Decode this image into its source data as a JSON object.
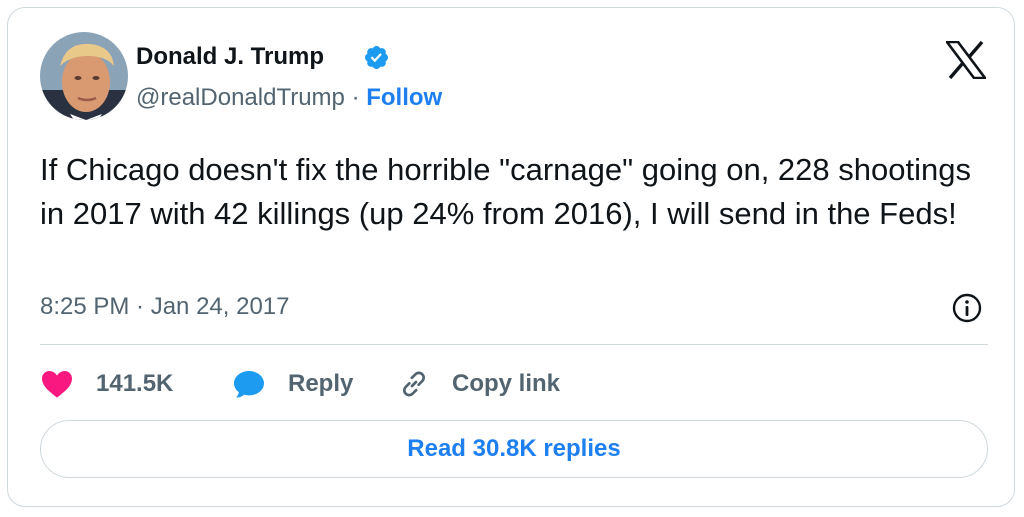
{
  "author": {
    "name": "Donald J. Trump",
    "handle": "@realDonaldTrump",
    "separator": "·",
    "follow_label": "Follow",
    "verified": true
  },
  "tweet": {
    "text": "If Chicago doesn't fix the horrible \"carnage\" going on, 228 shootings in 2017 with 42 killings (up 24% from 2016), I will send in the Feds!",
    "timestamp": "8:25 PM · Jan 24, 2017"
  },
  "actions": {
    "like_count": "141.5K",
    "reply_label": "Reply",
    "copy_label": "Copy link"
  },
  "read_replies_label": "Read 30.8K replies",
  "icons": {
    "platform": "x-logo-icon",
    "verified": "verified-badge-icon",
    "info": "info-icon",
    "like": "heart-icon",
    "reply": "speech-bubble-icon",
    "copy": "link-icon"
  },
  "colors": {
    "accent": "#1d9bf0",
    "link": "#1d7ff0",
    "like": "#f91880",
    "secondary_text": "#536471",
    "primary_text": "#0f1419",
    "border": "#cfd9de"
  }
}
